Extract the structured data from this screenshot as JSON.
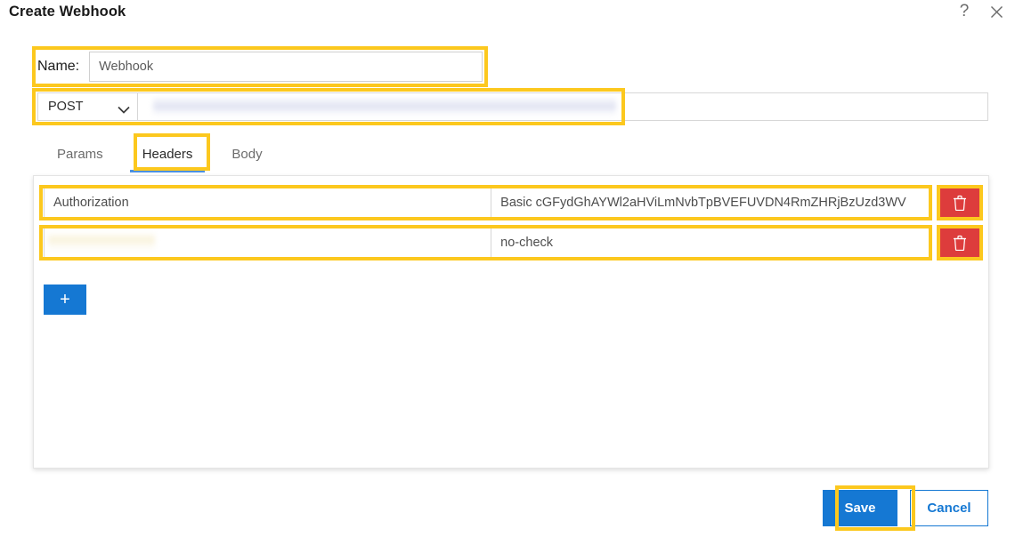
{
  "dialog": {
    "title": "Create Webhook",
    "help_icon": "help-question-icon",
    "close_icon": "close-x-icon",
    "help_glyph": "?"
  },
  "name_field": {
    "label": "Name:",
    "value": "Webhook",
    "placeholder": ""
  },
  "request": {
    "method": "POST",
    "method_caret_icon": "chevron-down-icon",
    "url": "",
    "url_placeholder": "",
    "url_redacted": true
  },
  "tabs": [
    {
      "id": "params",
      "label": "Params",
      "active": false
    },
    {
      "id": "headers",
      "label": "Headers",
      "active": true
    },
    {
      "id": "body",
      "label": "Body",
      "active": false
    }
  ],
  "headers": {
    "rows": [
      {
        "key": "Authorization",
        "key_redacted": false,
        "value": "Basic cGFydGhAYWl2aHViLmNvbTpBVEFUVDN4RmZHRjBzUzd3WV",
        "delete_icon": "trash-icon"
      },
      {
        "key": "",
        "key_redacted": true,
        "value": "no-check",
        "delete_icon": "trash-icon"
      }
    ],
    "add_label": "+",
    "add_icon": "plus-icon"
  },
  "footer": {
    "save_label": "Save",
    "cancel_label": "Cancel"
  },
  "colors": {
    "highlight": "#fcc81e",
    "primary": "#1578d3",
    "danger": "#dd3c3c",
    "tab_underline": "#4a90e2"
  }
}
